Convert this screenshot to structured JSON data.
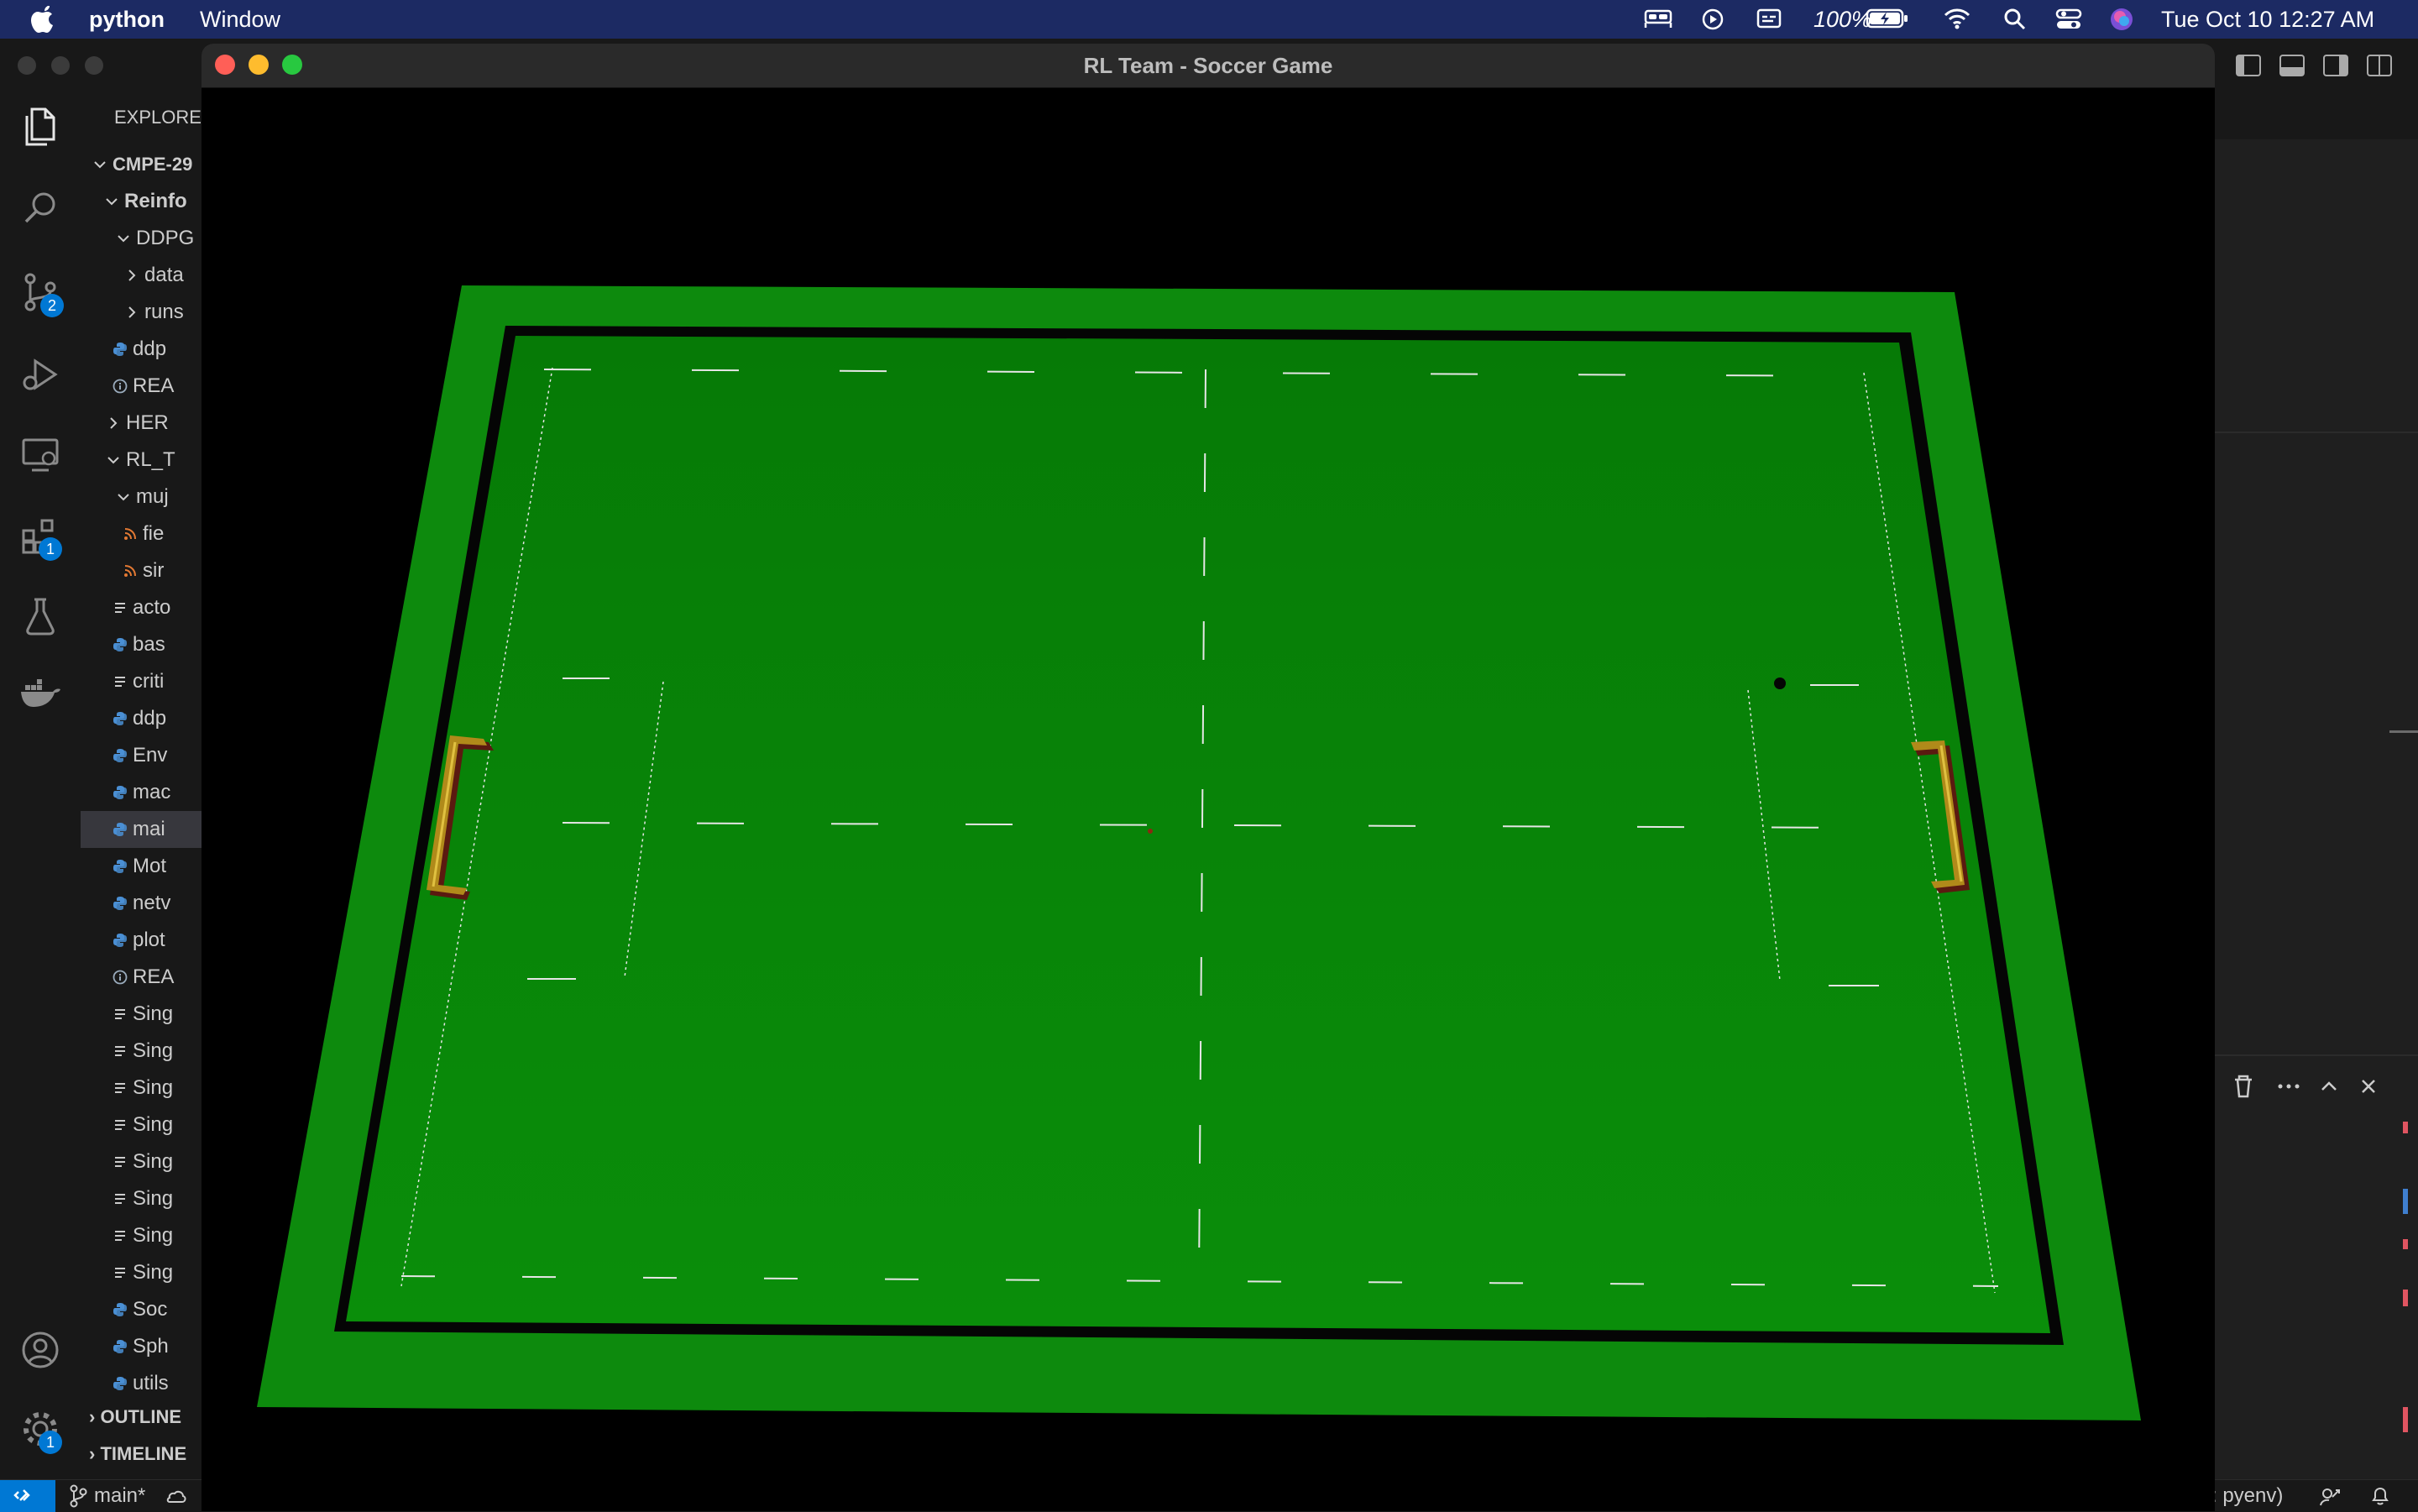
{
  "menubar": {
    "app_name": "python",
    "menu_window": "Window",
    "battery": "100%",
    "datetime": "Tue Oct 10  12:27 AM",
    "icons": [
      "apple-icon",
      "bed-icon",
      "play-circle-icon",
      "caption-icon",
      "battery-icon",
      "wifi-icon",
      "search-icon",
      "control-center-icon",
      "siri-icon"
    ]
  },
  "vscode": {
    "explorer_title": "EXPLORER",
    "tree": [
      {
        "label": "CMPE-29",
        "kind": "folder-open"
      },
      {
        "label": "Reinfo",
        "kind": "folder-open"
      },
      {
        "label": "DDPG",
        "kind": "folder-open"
      },
      {
        "label": "data",
        "kind": "folder-closed"
      },
      {
        "label": "runs",
        "kind": "folder-closed"
      },
      {
        "label": "ddp",
        "kind": "python"
      },
      {
        "label": "REA",
        "kind": "info"
      },
      {
        "label": "HER",
        "kind": "folder-closed"
      },
      {
        "label": "RL_T",
        "kind": "folder-open"
      },
      {
        "label": "muj",
        "kind": "folder-open"
      },
      {
        "label": "fie",
        "kind": "rss"
      },
      {
        "label": "sir",
        "kind": "rss"
      },
      {
        "label": "acto",
        "kind": "text"
      },
      {
        "label": "bas",
        "kind": "python"
      },
      {
        "label": "criti",
        "kind": "text"
      },
      {
        "label": "ddp",
        "kind": "python"
      },
      {
        "label": "Env",
        "kind": "python"
      },
      {
        "label": "mac",
        "kind": "python"
      },
      {
        "label": "mai",
        "kind": "python"
      },
      {
        "label": "Mot",
        "kind": "python"
      },
      {
        "label": "netv",
        "kind": "python"
      },
      {
        "label": "plot",
        "kind": "python"
      },
      {
        "label": "REA",
        "kind": "info"
      },
      {
        "label": "Sing",
        "kind": "text"
      },
      {
        "label": "Sing",
        "kind": "text"
      },
      {
        "label": "Sing",
        "kind": "text"
      },
      {
        "label": "Sing",
        "kind": "text"
      },
      {
        "label": "Sing",
        "kind": "text"
      },
      {
        "label": "Sing",
        "kind": "text"
      },
      {
        "label": "Sing",
        "kind": "text"
      },
      {
        "label": "Sing",
        "kind": "text"
      },
      {
        "label": "Soc",
        "kind": "python"
      },
      {
        "label": "Sph",
        "kind": "python"
      },
      {
        "label": "utils",
        "kind": "python"
      }
    ],
    "outline_label": "OUTLINE",
    "timeline_label": "TIMELINE",
    "badges": {
      "source_control": "2",
      "extensions": "1",
      "settings": "1"
    },
    "status_branch": "main*",
    "status_env": ": pyenv)"
  },
  "game_window": {
    "title": "RL Team - Soccer Game"
  },
  "colors": {
    "field_outer": "#0d8a0d",
    "field_inner": "#067c06",
    "boundary": "#050505",
    "line": "#e6e6e6",
    "goal_post": "#b08a1a",
    "menubar_bg": "#1c2a63"
  }
}
